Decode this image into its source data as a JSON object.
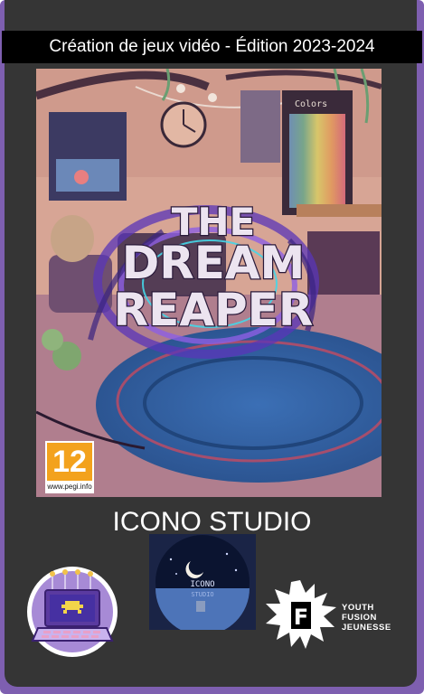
{
  "header": {
    "title": "Création de jeux vidéo - Édition 2023-2024"
  },
  "cover": {
    "game_title_lines": [
      "THE",
      "DREAM",
      "REAPER"
    ],
    "poster_text": "Colors",
    "pegi": {
      "rating": "12",
      "url": "www.pegi.info"
    }
  },
  "studio": {
    "name": "ICONO STUDIO",
    "logo_text_line1": "ICONO",
    "logo_text_line2": "STUDIO"
  },
  "sponsor": {
    "line1": "YOUTH",
    "line2": "FUSION",
    "line3": "JEUNESSE",
    "mark": "F"
  },
  "colors": {
    "frame": "#7e5fb0",
    "panel": "#353535",
    "spine": "#000000",
    "pegi": "#f3a21d"
  }
}
